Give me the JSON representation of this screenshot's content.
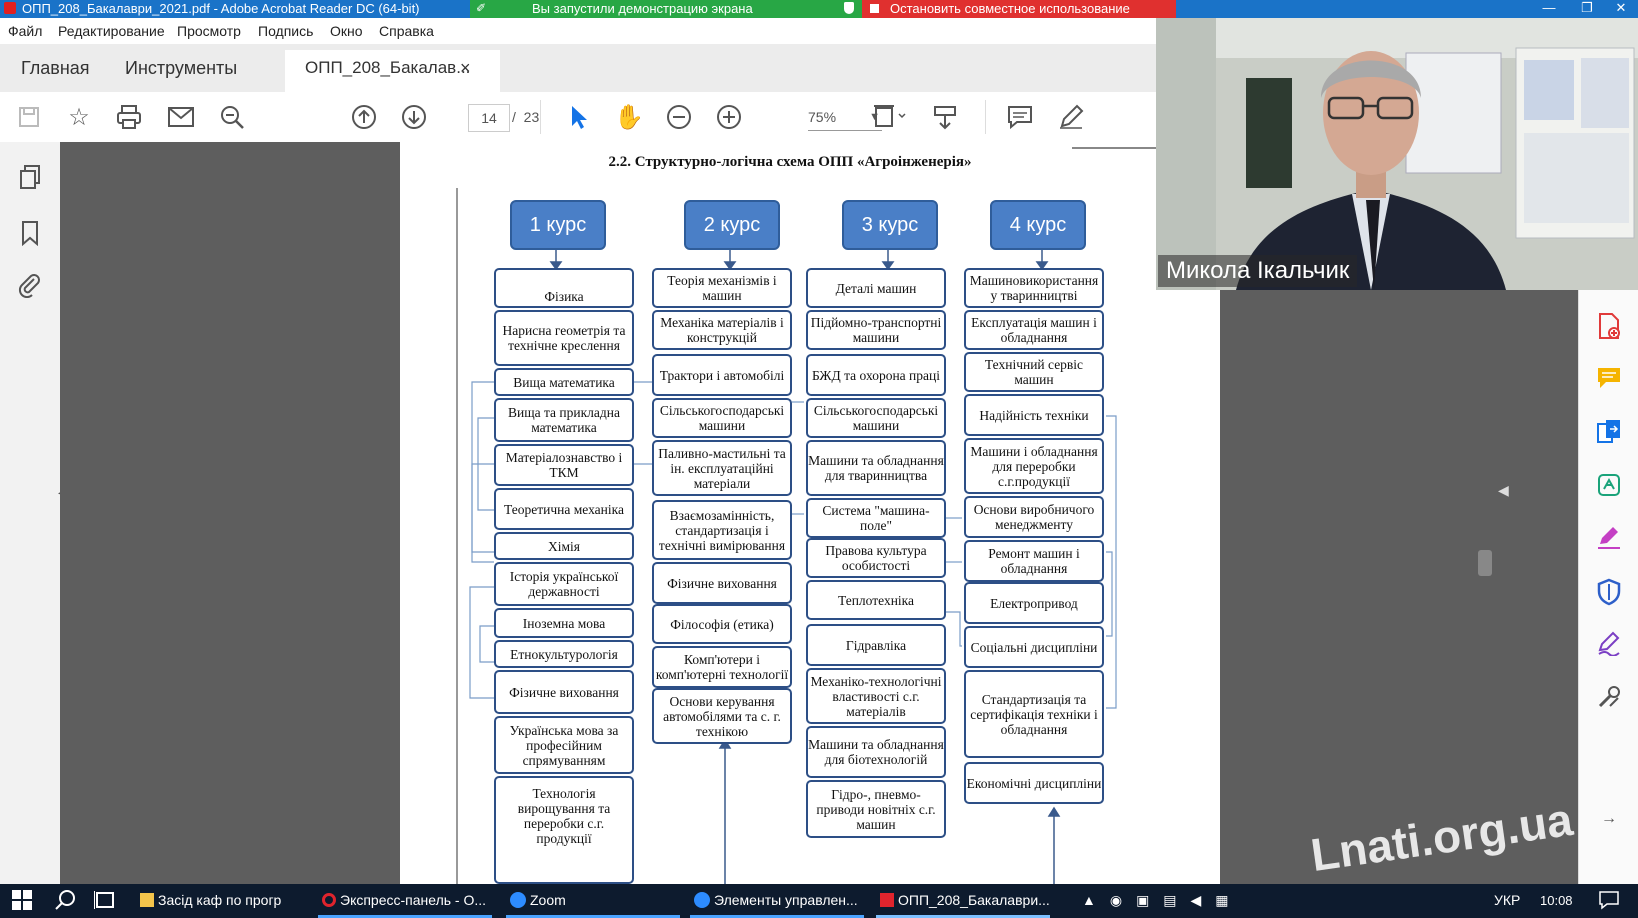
{
  "window": {
    "title": "ОПП_208_Бакалаври_2021.pdf - Adobe Acrobat Reader DC (64-bit)"
  },
  "share_banner": {
    "text": "Вы запустили демонстрацию экрана"
  },
  "stop_banner": {
    "text": "Остановить совместное использование"
  },
  "menu": [
    "Файл",
    "Редактирование",
    "Просмотр",
    "Подпись",
    "Окно",
    "Справка"
  ],
  "tabs": {
    "home": "Главная",
    "tools": "Инструменты",
    "doc": "ОПП_208_Бакалав...",
    "close": "×"
  },
  "toolbar": {
    "page_current": "14",
    "page_sep": "/",
    "page_total": "23",
    "zoom": "75%"
  },
  "document": {
    "heading": "2.2. Структурно-логічна схема ОПП «Агроінженерія»",
    "courses": [
      {
        "label": "1 курс",
        "subjects": [
          "Фізика",
          "Нарисна геометрія та технічне креслення",
          "Вища математика",
          "Вища та прикладна математика",
          "Матеріалознавство і ТКМ",
          "Теоретична механіка",
          "Хімія",
          "Історія української державності",
          "Іноземна мова",
          "Етнокультурологія",
          "Фізичне виховання",
          "Українська мова за професійним спрямуванням",
          "Технологія вирощування та переробки с.г. продукції"
        ]
      },
      {
        "label": "2 курс",
        "subjects": [
          "Теорія механізмів і машин",
          "Механіка матеріалів і конструкцій",
          "Трактори і автомобілі",
          "Сільськогосподарські машини",
          "Паливно-мастильні та ін. експлуатаційні матеріали",
          "Взаємозамінність, стандартизація і технічні вимірювання",
          "Фізичне виховання",
          "Філософія (етика)",
          "Комп'ютери і комп'ютерні технології",
          "Основи керування автомобілями та с. г. технікою"
        ]
      },
      {
        "label": "3 курс",
        "subjects": [
          "Деталі машин",
          "Підйомно-транспортні машини",
          "БЖД та охорона праці",
          "Сільськогосподарські машини",
          "Машини та обладнання для тваринництва",
          "Система \"машина-поле\"",
          "Правова культура особистості",
          "Теплотехніка",
          "Гідравліка",
          "Механіко-технологічні властивості с.г. матеріалів",
          "Машини та обладнання для біотехнологій",
          "Гідро-, пневмо-приводи новітніх с.г. машин"
        ]
      },
      {
        "label": "4 курс",
        "subjects": [
          "Машиновикористання у тваринництві",
          "Експлуатація машин і обладнання",
          "Технічний сервіс машин",
          "Надійність техніки",
          "Машини і обладнання для переробки с.г.продукції",
          "Основи виробничого менеджменту",
          "Ремонт машин і обладнання",
          "Електропривод",
          "Соціальні дисципліни",
          "Стандартизація та сертифікація техніки і обладнання",
          "Економічні дисципліни"
        ]
      }
    ]
  },
  "webcam": {
    "name": "Микола Ікальчик"
  },
  "taskbar": {
    "items": [
      "Засід каф по прогр",
      "Экспресс-панель - О...",
      "Zoom",
      "Элементы управлен...",
      "ОПП_208_Бакалаври..."
    ],
    "lang": "УКР",
    "time": "10:08"
  },
  "watermark": "Lnati.org.ua"
}
